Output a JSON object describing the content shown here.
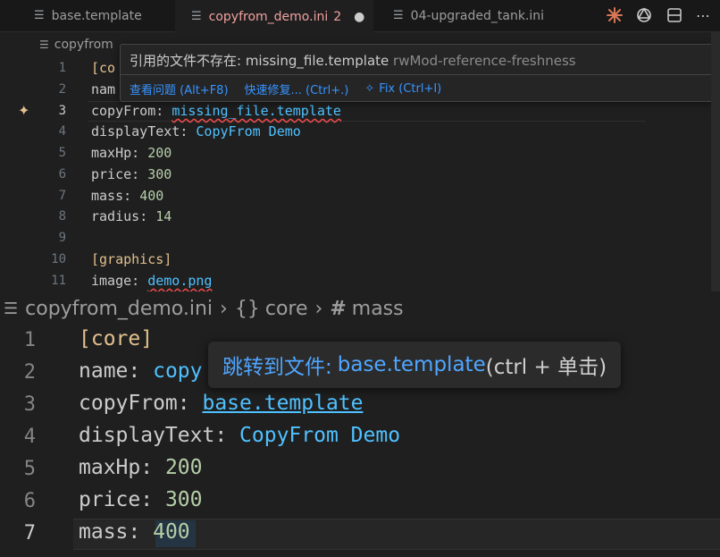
{
  "tabs": [
    {
      "label": "base.template"
    },
    {
      "label": "copyfrom_demo.ini",
      "badge": "2",
      "modified_dot": "●"
    },
    {
      "label": "04-upgraded_tank.ini"
    }
  ],
  "toolbar_icons": [
    "claude-icon",
    "openai-icon",
    "split-editor-icon"
  ],
  "top_editor": {
    "breadcrumb": "copyfrom",
    "lines": [
      {
        "n": "1",
        "key": "[co",
        "sep": "",
        "val": ""
      },
      {
        "n": "2",
        "key": "nam",
        "sep": "",
        "val": ""
      },
      {
        "n": "3",
        "key": "copyFrom",
        "sep": ": ",
        "val": "missing_file.template"
      },
      {
        "n": "4",
        "key": "displayText",
        "sep": ": ",
        "val": "CopyFrom Demo"
      },
      {
        "n": "5",
        "key": "maxHp",
        "sep": ": ",
        "val": "200"
      },
      {
        "n": "6",
        "key": "price",
        "sep": ": ",
        "val": "300"
      },
      {
        "n": "7",
        "key": "mass",
        "sep": ": ",
        "val": "400"
      },
      {
        "n": "8",
        "key": "radius",
        "sep": ": ",
        "val": "14"
      },
      {
        "n": "9",
        "key": "",
        "sep": "",
        "val": ""
      },
      {
        "n": "10",
        "key": "[graphics]",
        "sep": "",
        "val": ""
      },
      {
        "n": "11",
        "key": "image",
        "sep": ": ",
        "val": "demo.png"
      }
    ],
    "hover": {
      "message": "引用的文件不存在: missing_file.template",
      "code": "rwMod-reference-freshness",
      "actions": [
        "查看问题 (Alt+F8)",
        "快速修复... (Ctrl+.)",
        "Fix (Ctrl+I)"
      ]
    }
  },
  "bottom_editor": {
    "breadcrumb": [
      "copyfrom_demo.ini",
      "core",
      "mass"
    ],
    "lines": [
      {
        "n": "1",
        "key": "[core]",
        "sep": "",
        "val": ""
      },
      {
        "n": "2",
        "key": "name",
        "sep": ": ",
        "val": "copy"
      },
      {
        "n": "3",
        "key": "copyFrom",
        "sep": ": ",
        "val": "base.template"
      },
      {
        "n": "4",
        "key": "displayText",
        "sep": ": ",
        "val": "CopyFrom Demo"
      },
      {
        "n": "5",
        "key": "maxHp",
        "sep": ": ",
        "val": "200"
      },
      {
        "n": "6",
        "key": "price",
        "sep": ": ",
        "val": "300"
      },
      {
        "n": "7",
        "key": "mass",
        "sep": ": ",
        "val": "400"
      }
    ],
    "tooltip": {
      "prefix": "跳转到文件: ",
      "file": "base.template",
      "suffix": " (ctrl + 单击)"
    }
  },
  "colors": {
    "key": "#cccccc",
    "section": "#e2c08d",
    "string": "#4fc1ff",
    "number": "#b5cea8",
    "error": "#f14c4c"
  }
}
